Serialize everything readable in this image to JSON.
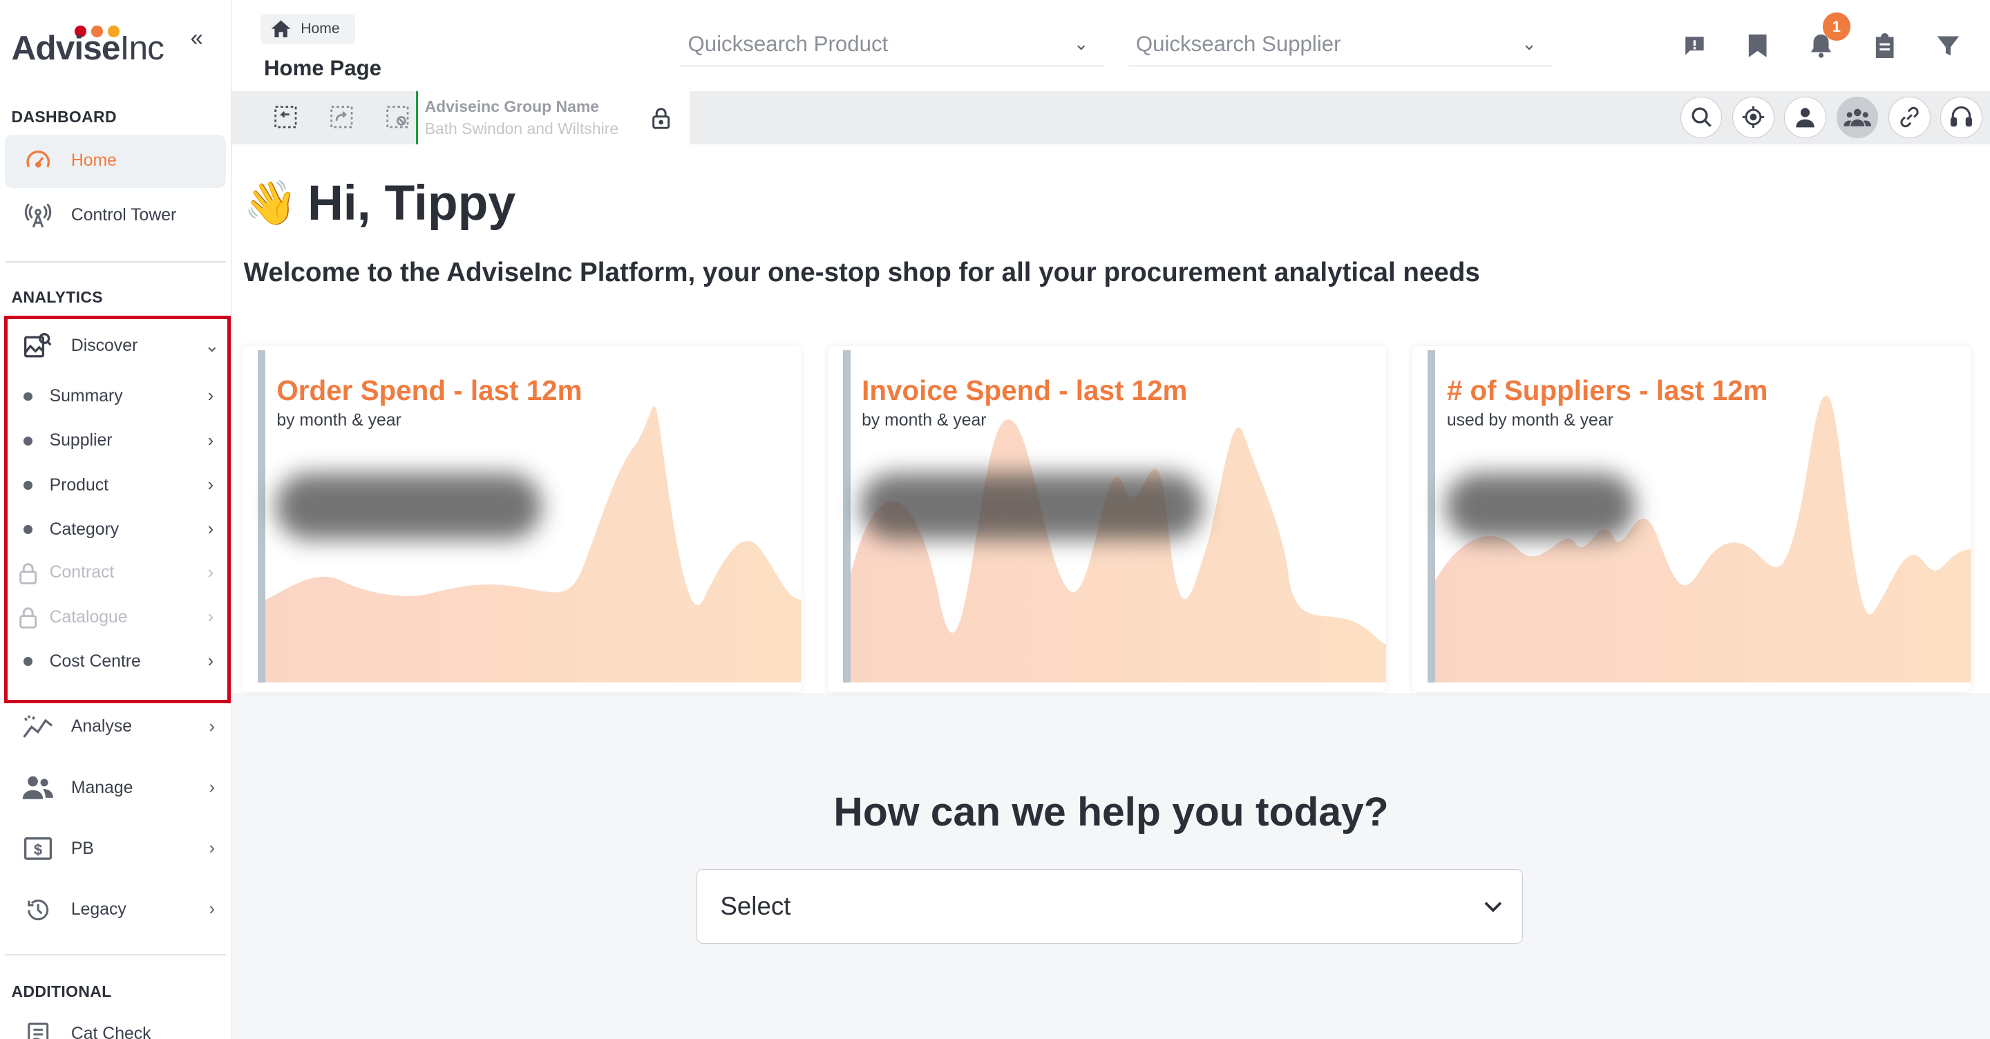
{
  "brand": {
    "logo_bold": "Advise",
    "logo_light": "Inc",
    "dot_colors": [
      "#d0021b",
      "#f07b3f",
      "#f5a623"
    ],
    "accent": "#f07b3f"
  },
  "sidebar": {
    "collapse_icon": "«",
    "dashboard_header": "DASHBOARD",
    "dashboard_items": [
      {
        "label": "Home",
        "icon": "speedometer-icon",
        "active": true
      },
      {
        "label": "Control Tower",
        "icon": "antenna-icon",
        "active": false
      }
    ],
    "analytics_header": "ANALYTICS",
    "discover": {
      "label": "Discover",
      "icon": "discover-image-search-icon",
      "expanded": true
    },
    "discover_items": [
      {
        "label": "Summary",
        "locked": false
      },
      {
        "label": "Supplier",
        "locked": false
      },
      {
        "label": "Product",
        "locked": false
      },
      {
        "label": "Category",
        "locked": false
      },
      {
        "label": "Contract",
        "locked": true
      },
      {
        "label": "Catalogue",
        "locked": true
      },
      {
        "label": "Cost Centre",
        "locked": false
      }
    ],
    "analytics_items": [
      {
        "label": "Analyse",
        "icon": "trend-chart-icon"
      },
      {
        "label": "Manage",
        "icon": "people-icon"
      },
      {
        "label": "PB",
        "icon": "dollar-sign-icon"
      },
      {
        "label": "Legacy",
        "icon": "history-clock-icon"
      }
    ],
    "additional_header": "ADDITIONAL",
    "additional_items": [
      {
        "label": "Cat Check",
        "icon": "list-document-icon"
      }
    ]
  },
  "topbar": {
    "breadcrumb": "Home",
    "page_title": "Home Page",
    "quicksearch_product": "Quicksearch Product",
    "quicksearch_supplier": "Quicksearch Supplier",
    "notification_count": "1",
    "icons": [
      "feedback-icon",
      "bookmark-icon",
      "bell-icon",
      "clipboard-icon",
      "filter-icon"
    ]
  },
  "toolbar": {
    "left_icons": [
      "collapse-select-icon",
      "share-select-icon",
      "clear-select-icon"
    ],
    "group_label": "Adviseinc Group Name",
    "group_value": "Bath Swindon and Wiltshire",
    "right_icons": [
      "search-icon",
      "target-icon",
      "user-icon",
      "group-icon",
      "link-icon",
      "headset-icon"
    ],
    "active_right": "group-icon"
  },
  "main": {
    "wave": "👋",
    "greeting": "Hi, Tippy",
    "welcome": "Welcome to the AdviseInc Platform, your one-stop shop for all your procurement analytical needs",
    "cards": [
      {
        "title": "Order Spend - last 12m",
        "subtitle": "by month & year"
      },
      {
        "title": "Invoice Spend - last 12m",
        "subtitle": "by month & year"
      },
      {
        "title": "# of Suppliers - last 12m",
        "subtitle": "used by month & year"
      }
    ],
    "help_title": "How can we help you today?",
    "select_value": "Select"
  }
}
